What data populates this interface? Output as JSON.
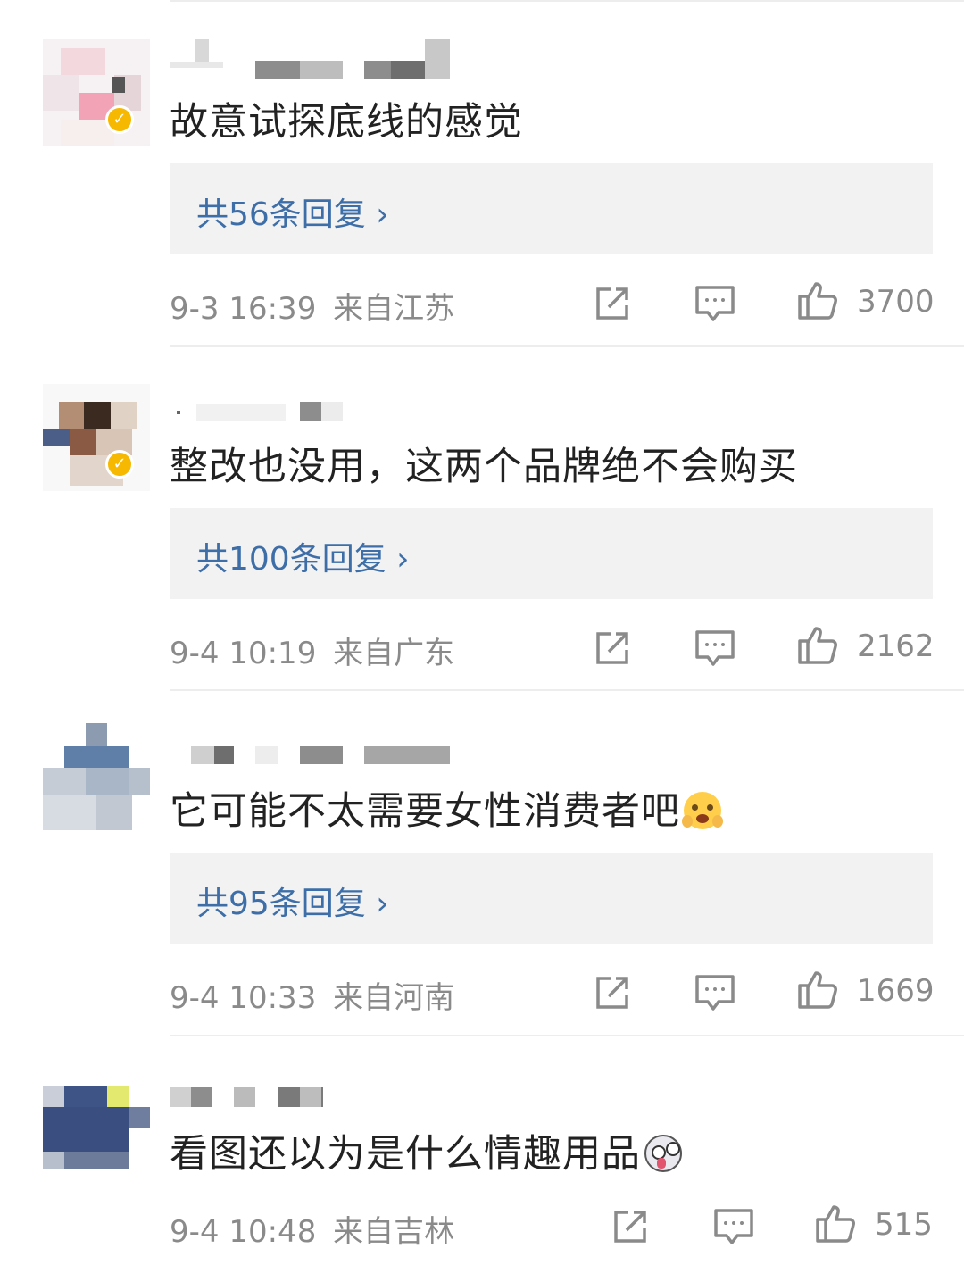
{
  "comments": [
    {
      "text": "故意试探底线的感觉",
      "replies": "共56条回复",
      "time": "9-3 16:39",
      "location": "来自江苏",
      "likes": "3700",
      "verified": true
    },
    {
      "text": "整改也没用，这两个品牌绝不会购买",
      "replies": "共100条回复",
      "time": "9-4 10:19",
      "location": "来自广东",
      "likes": "2162",
      "verified": true
    },
    {
      "text": "它可能不太需要女性消费者吧",
      "emoji": "face-with-hands-emoji",
      "replies": "共95条回复",
      "time": "9-4 10:33",
      "location": "来自河南",
      "likes": "1669",
      "verified": false
    },
    {
      "text": "看图还以为是什么情趣用品",
      "emoji": "crazy-face-emoji",
      "time": "9-4 10:48",
      "location": "来自吉林",
      "likes": "515",
      "verified": false
    }
  ],
  "icons": {
    "share": "share-icon",
    "comment": "comment-icon",
    "like": "thumbs-up-icon"
  },
  "colors": {
    "link": "#3d6ea8",
    "meta": "#8a8a8a",
    "verified_badge": "#f6b800"
  }
}
